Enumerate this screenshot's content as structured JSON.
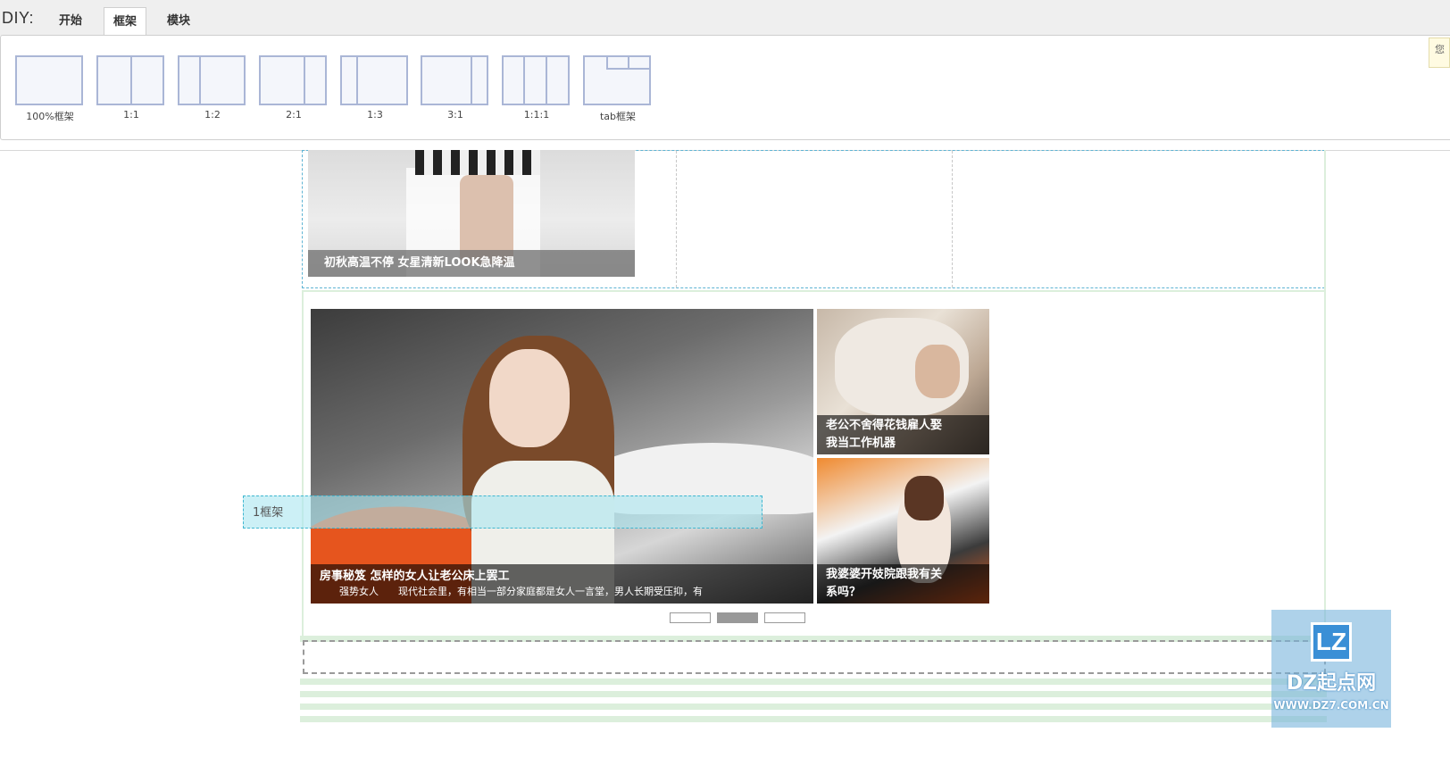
{
  "toolbar": {
    "label": "DIY:",
    "tabs": [
      {
        "label": "开始"
      },
      {
        "label": "框架"
      },
      {
        "label": "模块"
      }
    ],
    "active_tab": "框架",
    "frames": [
      {
        "label": "100%框架"
      },
      {
        "label": "1:1"
      },
      {
        "label": "1:2"
      },
      {
        "label": "2:1"
      },
      {
        "label": "1:3"
      },
      {
        "label": "3:1"
      },
      {
        "label": "1:1:1"
      },
      {
        "label": "tab框架"
      }
    ],
    "hint_text": "您"
  },
  "content": {
    "top_caption": "初秋高温不停 女星清新LOOK急降温",
    "main_slide": {
      "title": "房事秘笈 怎样的女人让老公床上罢工",
      "source": "强势女人",
      "desc": "现代社会里，有相当一部分家庭都是女人一言堂，男人长期受压抑，有"
    },
    "side_items": [
      {
        "caption_line1": "老公不舍得花钱雇人娶",
        "caption_line2": "我当工作机器"
      },
      {
        "caption_line1": "我婆婆开妓院跟我有关",
        "caption_line2": "系吗？"
      }
    ],
    "pager": {
      "count": 3,
      "active_index": 1
    },
    "drag_placeholder": "1框架"
  },
  "watermark": {
    "logo": "LZ",
    "title": "DZ起点网",
    "url": "WWW.DZ7.COM.CN"
  },
  "colors": {
    "frame_icon_border": "#aab6d6",
    "frame_dashed": "#5db3d3",
    "stripe": "#dcefdc",
    "placeholder": "#aae6f0"
  }
}
